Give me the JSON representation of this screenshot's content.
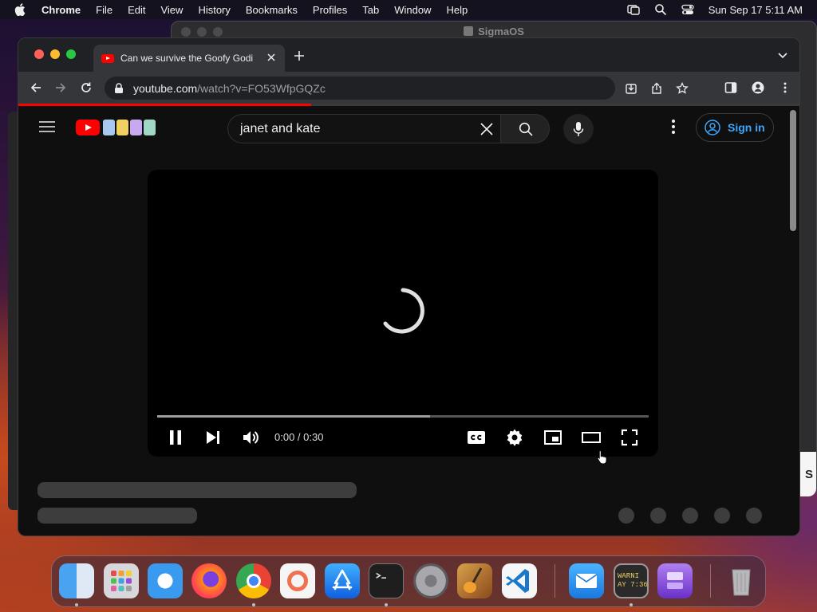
{
  "menubar": {
    "app": "Chrome",
    "items": [
      "File",
      "Edit",
      "View",
      "History",
      "Bookmarks",
      "Profiles",
      "Tab",
      "Window",
      "Help"
    ],
    "datetime": "Sun Sep 17  5:11 AM"
  },
  "background_window": {
    "title": "SigmaOS",
    "edge_text": "S"
  },
  "browser": {
    "tab": {
      "title": "Can we survive the Goofy Godi",
      "favicon": "youtube-favicon"
    },
    "address": {
      "host": "youtube.com",
      "path": "/watch?v=FO53WfpGQZc"
    },
    "load_progress": 0.375
  },
  "youtube": {
    "search": {
      "value": "janet and kate"
    },
    "signin_label": "Sign in",
    "player": {
      "time": "0:00 / 0:30",
      "buffered": 0.555,
      "state": "loading"
    }
  },
  "dock": {
    "apps": [
      "Finder",
      "Launchpad",
      "Safari",
      "Firefox",
      "Chrome",
      "Scrobbles",
      "App Store",
      "Terminal",
      "System Settings",
      "GarageBand",
      "Visual Studio Code",
      "Mail",
      "Console",
      "Apple Configurator",
      "Trash"
    ],
    "console_icon_text": "WARNI\nAY 7:36"
  },
  "colors": {
    "accent": "#3ea6ff",
    "youtube_red": "#ff0000",
    "page_bg": "#0f0f0f"
  }
}
